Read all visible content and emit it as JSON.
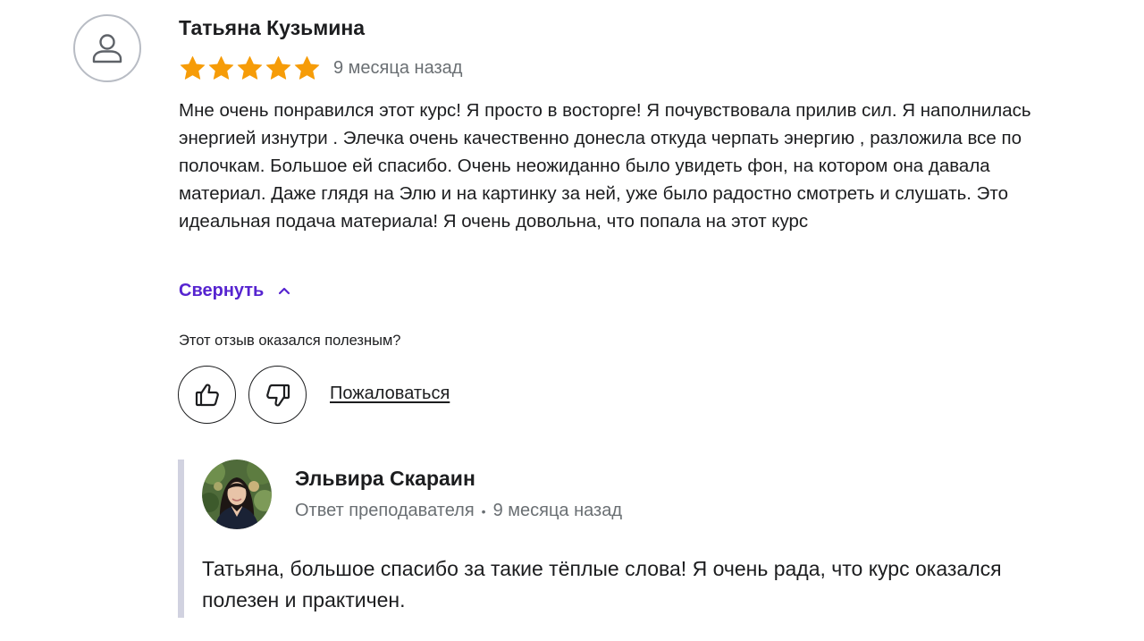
{
  "review": {
    "author": "Татьяна Кузьмина",
    "avatar_icon": "user-icon",
    "rating": 5,
    "rating_max": 5,
    "star_color": "#f69c08",
    "date": "9 месяца назад",
    "text": "Мне очень понравился этот курс! Я просто в восторге! Я почувствовала прилив сил. Я наполнилась энергией изнутри . Элечка очень качественно донесла откуда черпать энергию , разложила все по полочкам. Большое ей спасибо. Очень неожиданно было увидеть фон, на котором она давала материал. Даже глядя на Элю и на картинку за ней, уже было радостно смотреть и слушать. Это идеальная подача материала! Я очень довольна, что попала на этот курс",
    "collapse_label": "Свернуть",
    "collapse_icon": "chevron-up-icon",
    "accent_color": "#5624d0"
  },
  "feedback": {
    "question": "Этот отзыв оказался полезным?",
    "like_icon": "thumbs-up-icon",
    "dislike_icon": "thumbs-down-icon",
    "report_label": "Пожаловаться"
  },
  "reply": {
    "author": "Эльвира Скараин",
    "role": "Ответ преподавателя",
    "separator": "•",
    "date": "9 месяца назад",
    "text": "Татьяна, большое спасибо за такие тёплые слова! Я очень рада, что курс оказался полезен и практичен.",
    "border_color": "#d1d2e0"
  }
}
